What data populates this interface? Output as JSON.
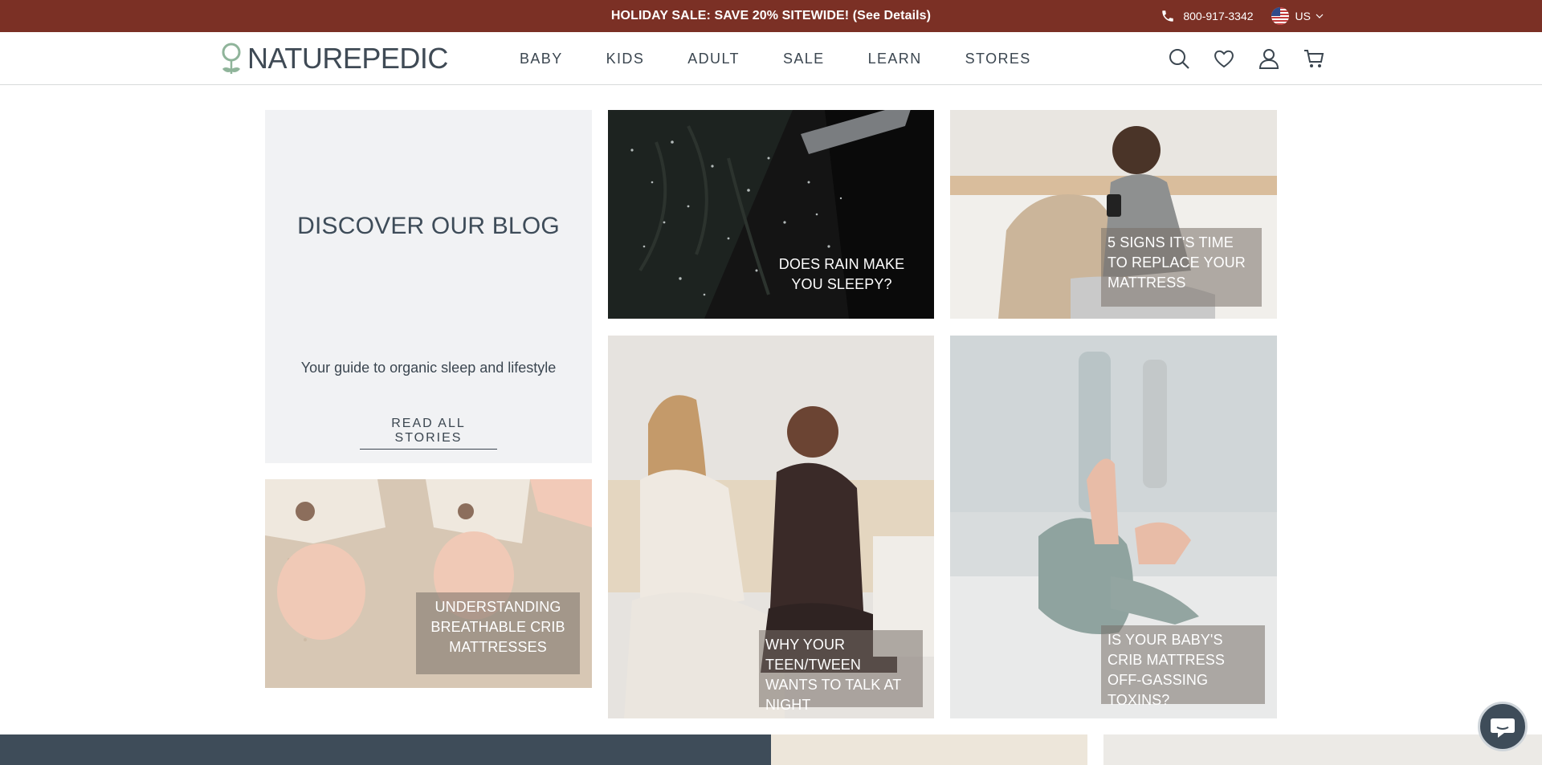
{
  "promo": {
    "text": "HOLIDAY SALE: SAVE 20% SITEWIDE! (See Details)",
    "phone": "800-917-3342",
    "country": "US",
    "phone_icon": "phone-icon",
    "flag_icon": "us-flag-icon"
  },
  "header": {
    "logo": "NATUREPEDIC",
    "nav": [
      "BABY",
      "KIDS",
      "ADULT",
      "SALE",
      "LEARN",
      "STORES"
    ],
    "icons": [
      "search-icon",
      "heart-icon",
      "user-icon",
      "cart-icon"
    ]
  },
  "blog": {
    "title": "DISCOVER OUR BLOG",
    "subtitle": "Your guide to organic sleep and lifestyle",
    "link": "READ ALL STORIES",
    "posts": [
      {
        "title": "DOES RAIN MAKE YOU SLEEPY?"
      },
      {
        "title": "5 SIGNS IT'S TIME TO REPLACE YOUR MATTRESS"
      },
      {
        "title": "UNDERSTANDING BREATHABLE CRIB MATTRESSES"
      },
      {
        "title": "WHY YOUR TEEN/TWEEN WANTS TO TALK AT NIGHT"
      },
      {
        "title": "IS YOUR BABY'S CRIB MATTRESS OFF-GASSING TOXINS?"
      }
    ]
  },
  "chat": {
    "icon": "chat-icon"
  },
  "colors": {
    "promo_bg": "#7b3025",
    "text": "#3b4650",
    "intro_bg": "#f1f2f4",
    "band_dark": "#3e4c59"
  }
}
